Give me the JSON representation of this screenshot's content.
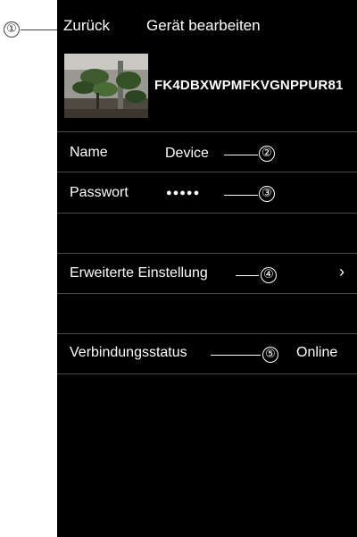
{
  "callouts": [
    "①",
    "②",
    "③",
    "④",
    "⑤"
  ],
  "nav": {
    "back_label": "Zurück",
    "title": "Gerät bearbeiten"
  },
  "device": {
    "id": "FK4DBXWPMFKVGNPPUR81"
  },
  "fields": {
    "name_label": "Name",
    "name_value": "Device",
    "password_label": "Passwort",
    "password_value": "●●●●●"
  },
  "advanced": {
    "label": "Erweiterte Einstellung",
    "chevron": "›"
  },
  "status": {
    "label": "Verbindungsstatus",
    "value": "Online"
  },
  "colors": {
    "screen_bg": "#000000",
    "page_bg": "#ffffff",
    "text": "#ffffff",
    "divider": "#4a4a4a"
  },
  "icons": [
    "chevron-right-icon",
    "device-thumbnail"
  ]
}
